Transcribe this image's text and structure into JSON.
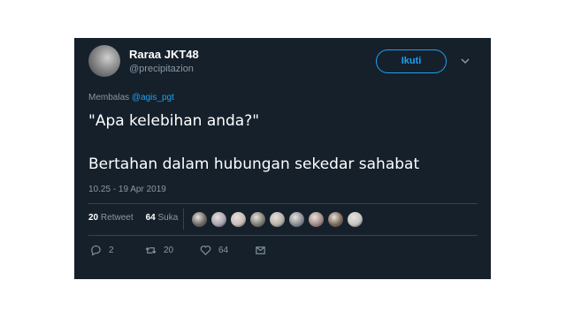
{
  "tweet": {
    "user": {
      "name": "Raraa JKT48",
      "handle": "@precipitazion"
    },
    "follow_label": "Ikuti",
    "reply_prefix": "Membalas ",
    "reply_mention": "@agis_pgt",
    "text_line1": "\"Apa kelebihan anda?\"",
    "text_line2": "Bertahan dalam hubungan sekedar sahabat",
    "timestamp": "10.25 - 19 Apr 2019",
    "stats": {
      "retweets_count": "20",
      "retweets_label": "Retweet",
      "likes_count": "64",
      "likes_label": "Suka"
    },
    "likers": [
      {
        "icon": "liker-avatar",
        "color": "#6d6a66"
      },
      {
        "icon": "liker-avatar",
        "color": "#a9a4b0"
      },
      {
        "icon": "liker-avatar",
        "color": "#c9bcb7"
      },
      {
        "icon": "liker-avatar",
        "color": "#7d7f74"
      },
      {
        "icon": "liker-avatar",
        "color": "#b8b2ab"
      },
      {
        "icon": "liker-avatar",
        "color": "#8a8d95"
      },
      {
        "icon": "liker-avatar",
        "color": "#a58b86"
      },
      {
        "icon": "liker-avatar",
        "color": "#7b6a5c"
      },
      {
        "icon": "liker-avatar",
        "color": "#c6c5c2"
      }
    ],
    "actions": {
      "reply_count": "2",
      "retweet_count": "20",
      "like_count": "64"
    }
  },
  "colors": {
    "background": "#15202b",
    "accent": "#1da1f2",
    "secondary_text": "#8899a6",
    "divider": "#38444d"
  }
}
